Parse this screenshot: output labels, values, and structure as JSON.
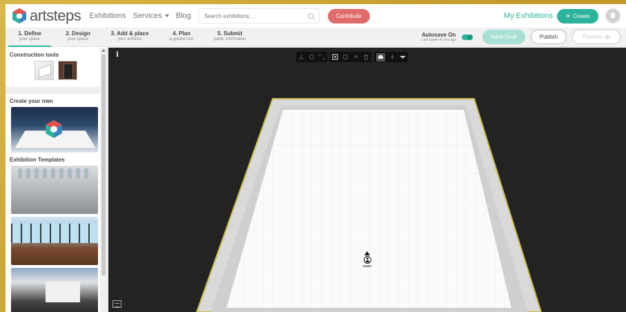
{
  "header": {
    "logo_text": "artsteps",
    "nav": [
      {
        "label": "Exhibitions"
      },
      {
        "label": "Services"
      },
      {
        "label": "Blog"
      }
    ],
    "search_placeholder": "Search exhibitions...",
    "contribute_label": "Contribute",
    "my_exhibitions_label": "My Exhibitions",
    "create_label": "Create"
  },
  "steps": [
    {
      "title": "1. Define",
      "subtitle": "your space",
      "active": true
    },
    {
      "title": "2. Design",
      "subtitle": "your space",
      "active": false
    },
    {
      "title": "3. Add & place",
      "subtitle": "your artifacts",
      "active": false
    },
    {
      "title": "4. Plan",
      "subtitle": "a guided tour",
      "active": false
    },
    {
      "title": "5. Submit",
      "subtitle": "public information",
      "active": false
    }
  ],
  "autosave": {
    "title": "Autosave On",
    "subtitle": "Last saved 47 sec ago",
    "enabled": true
  },
  "actions": {
    "save_draft": "Save Draft",
    "publish": "Publish",
    "preview": "Preview"
  },
  "sidebar": {
    "construction_title": "Construction tools",
    "create_own_title": "Create your own",
    "templates_title": "Exhibition Templates"
  },
  "viewport": {
    "info_label": "i",
    "start_label": "START"
  },
  "colors": {
    "accent": "#2db39b",
    "contribute": "#e06b6b",
    "viewport_bg": "#232323"
  }
}
